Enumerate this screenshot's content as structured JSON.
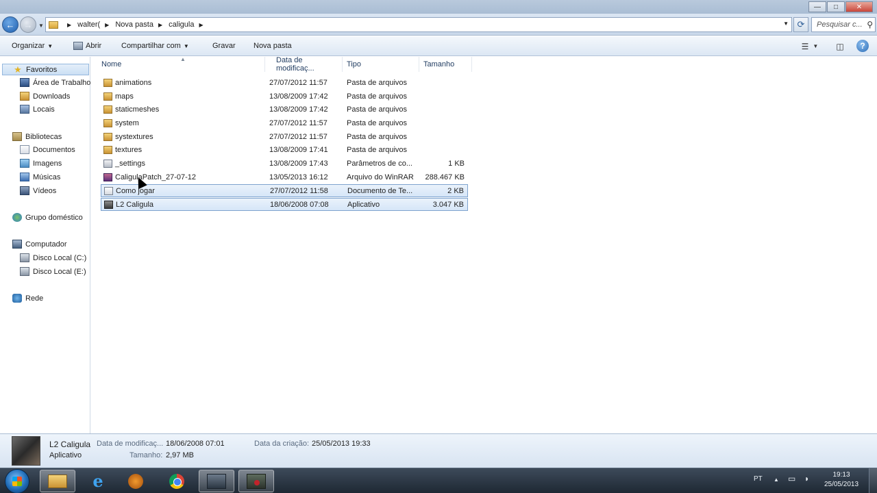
{
  "titlebar": {
    "minimize": "—",
    "maximize": "□",
    "close": "✕"
  },
  "navigation": {
    "back_icon": "←",
    "breadcrumbs": [
      "walter(",
      "Nova pasta",
      "caligula"
    ],
    "search_placeholder": "Pesquisar c...",
    "refresh_icon": "⟳",
    "search_icon": "⚲"
  },
  "commandbar": {
    "organize": "Organizar",
    "open": "Abrir",
    "share": "Compartilhar com",
    "burn": "Gravar",
    "new_folder": "Nova pasta",
    "view_icon": "☰",
    "preview_icon": "◫",
    "help_icon": "?"
  },
  "sidebar": {
    "favorites": {
      "label": "Favoritos",
      "items": [
        {
          "label": "Área de Trabalho",
          "icon": "desktop-icon"
        },
        {
          "label": "Downloads",
          "icon": "downloads-icon"
        },
        {
          "label": "Locais",
          "icon": "recent-places-icon"
        }
      ]
    },
    "libraries": {
      "label": "Bibliotecas",
      "items": [
        {
          "label": "Documentos",
          "icon": "documents-icon"
        },
        {
          "label": "Imagens",
          "icon": "pictures-icon"
        },
        {
          "label": "Músicas",
          "icon": "music-icon"
        },
        {
          "label": "Vídeos",
          "icon": "videos-icon"
        }
      ]
    },
    "homegroup": {
      "label": "Grupo doméstico"
    },
    "computer": {
      "label": "Computador",
      "items": [
        {
          "label": "Disco Local (C:)",
          "icon": "disk-icon"
        },
        {
          "label": "Disco Local (E:)",
          "icon": "disk-icon"
        }
      ]
    },
    "network": {
      "label": "Rede"
    }
  },
  "filelist": {
    "columns": [
      "Nome",
      "Data de modificaç...",
      "Tipo",
      "Tamanho"
    ],
    "rows": [
      {
        "name": "animations",
        "date": "27/07/2012 11:57",
        "type": "Pasta de arquivos",
        "size": "",
        "icon": "folder",
        "selected": false
      },
      {
        "name": "maps",
        "date": "13/08/2009 17:42",
        "type": "Pasta de arquivos",
        "size": "",
        "icon": "folder",
        "selected": false
      },
      {
        "name": "staticmeshes",
        "date": "13/08/2009 17:42",
        "type": "Pasta de arquivos",
        "size": "",
        "icon": "folder",
        "selected": false
      },
      {
        "name": "system",
        "date": "27/07/2012 11:57",
        "type": "Pasta de arquivos",
        "size": "",
        "icon": "folder",
        "selected": false
      },
      {
        "name": "systextures",
        "date": "27/07/2012 11:57",
        "type": "Pasta de arquivos",
        "size": "",
        "icon": "folder",
        "selected": false
      },
      {
        "name": "textures",
        "date": "13/08/2009 17:41",
        "type": "Pasta de arquivos",
        "size": "",
        "icon": "folder",
        "selected": false
      },
      {
        "name": "_settings",
        "date": "13/08/2009 17:43",
        "type": "Parâmetros de co...",
        "size": "1 KB",
        "icon": "cfg",
        "selected": false
      },
      {
        "name": "CaligulaPatch_27-07-12",
        "date": "13/05/2013 16:12",
        "type": "Arquivo do WinRAR",
        "size": "288.467 KB",
        "icon": "rar",
        "selected": false
      },
      {
        "name": "Como jogar",
        "date": "27/07/2012 11:58",
        "type": "Documento de Te...",
        "size": "2 KB",
        "icon": "txt",
        "selected": true
      },
      {
        "name": "L2 Caligula",
        "date": "18/06/2008 07:08",
        "type": "Aplicativo",
        "size": "3.047 KB",
        "icon": "app",
        "selected": true
      }
    ]
  },
  "details": {
    "name": "L2 Caligula",
    "type": "Aplicativo",
    "modified_label": "Data de modificaç...",
    "modified_value": "18/06/2008 07:01",
    "created_label": "Data da criação:",
    "created_value": "25/05/2013 19:33",
    "size_label": "Tamanho:",
    "size_value": "2,97 MB"
  },
  "taskbar": {
    "tray_lang": "PT",
    "tray_arrow": "▲",
    "tray_icons": [
      "▭",
      "◗"
    ],
    "clock_time": "19:13",
    "clock_date": "25/05/2013"
  }
}
